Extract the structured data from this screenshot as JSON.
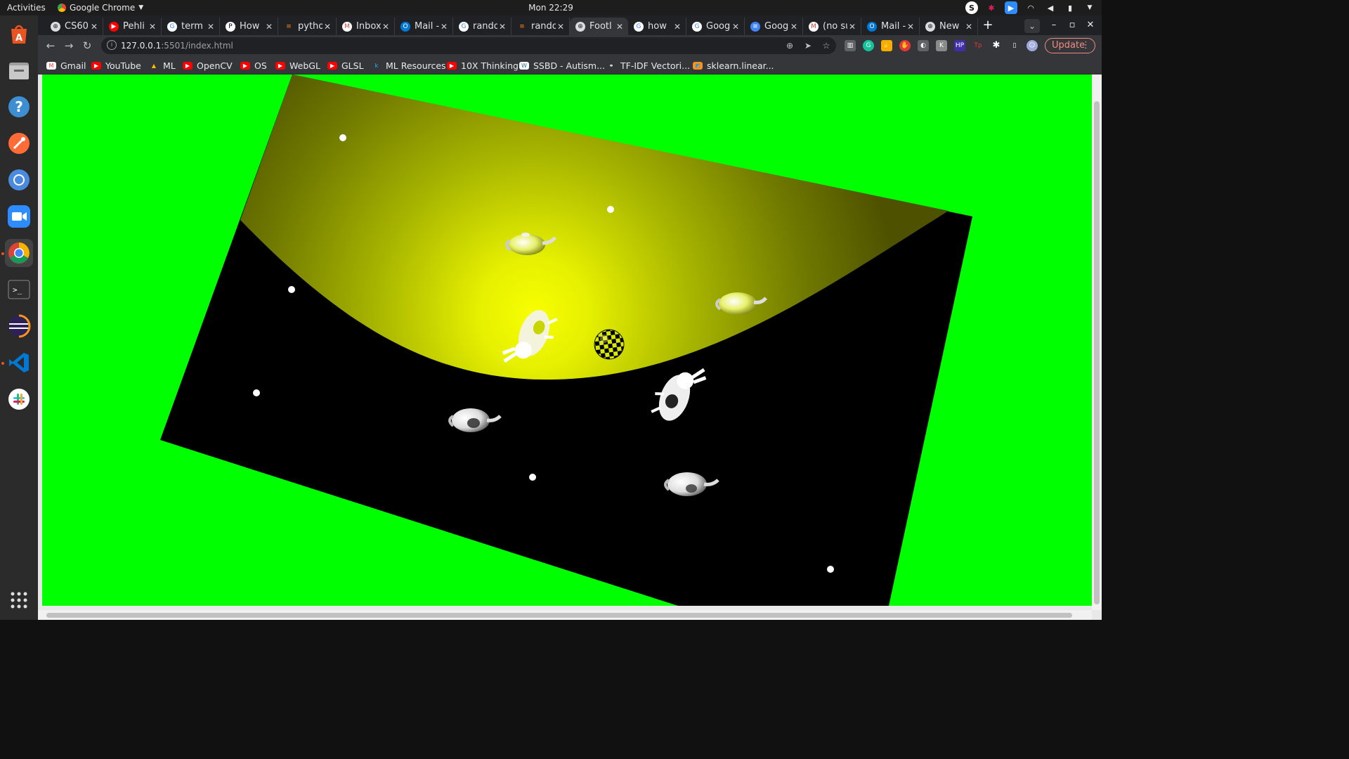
{
  "topbar": {
    "activities": "Activities",
    "app_name": "Google Chrome",
    "clock": "Mon 22:29"
  },
  "dock": {
    "items": [
      "software-center-icon",
      "files-icon",
      "help-icon",
      "postman-icon",
      "chromium-icon",
      "zoom-icon",
      "chrome-icon",
      "terminal-icon",
      "eclipse-icon",
      "vscode-icon",
      "slack-icon"
    ],
    "apps_grid": "show-applications-icon"
  },
  "tabs": [
    {
      "title": "CS60",
      "icon": "chrome-page-icon"
    },
    {
      "title": "Pehli",
      "icon": "youtube-icon"
    },
    {
      "title": "term",
      "icon": "google-icon"
    },
    {
      "title": "How",
      "icon": "p-icon"
    },
    {
      "title": "pytho",
      "icon": "stackoverflow-icon"
    },
    {
      "title": "Inbox",
      "icon": "gmail-icon"
    },
    {
      "title": "Mail -",
      "icon": "outlook-icon"
    },
    {
      "title": "rando",
      "icon": "google-icon"
    },
    {
      "title": "rando",
      "icon": "stackoverflow-icon"
    },
    {
      "title": "Footl",
      "icon": "chrome-page-icon",
      "active": true
    },
    {
      "title": "how",
      "icon": "google-icon"
    },
    {
      "title": "Goog",
      "icon": "google-icon"
    },
    {
      "title": "Goog",
      "icon": "docs-icon"
    },
    {
      "title": "(no su",
      "icon": "gmail-icon"
    },
    {
      "title": "Mail -",
      "icon": "outlook-icon"
    },
    {
      "title": "New",
      "icon": "chrome-page-icon"
    }
  ],
  "toolbar": {
    "url_host": "127.0.0.1",
    "url_rest": ":5501/index.html",
    "update_label": "Update"
  },
  "bookmarks": [
    {
      "label": "Gmail",
      "icon": "gmail-icon"
    },
    {
      "label": "YouTube",
      "icon": "youtube-icon"
    },
    {
      "label": "ML",
      "icon": "drive-icon"
    },
    {
      "label": "OpenCV",
      "icon": "youtube-icon"
    },
    {
      "label": "OS",
      "icon": "youtube-icon"
    },
    {
      "label": "WebGL",
      "icon": "youtube-icon"
    },
    {
      "label": "GLSL",
      "icon": "youtube-icon"
    },
    {
      "label": "ML Resources",
      "icon": "k-icon"
    },
    {
      "label": "10X Thinking",
      "icon": "youtube-icon"
    },
    {
      "label": "SSBD - Autism...",
      "icon": "wordpress-icon"
    },
    {
      "label": "TF-IDF Vectori...",
      "icon": "link-icon"
    },
    {
      "label": "sklearn.linear...",
      "icon": "sklearn-icon"
    }
  ],
  "scene": {
    "background": "#00ff00",
    "floor": "#000000",
    "spotlight": "#ffff00",
    "objects": [
      "teapot",
      "teapot",
      "teapot",
      "teapot",
      "bunny",
      "bunny",
      "checkered-ball",
      "light-marker",
      "light-marker",
      "light-marker",
      "light-marker",
      "light-marker",
      "light-marker"
    ]
  }
}
